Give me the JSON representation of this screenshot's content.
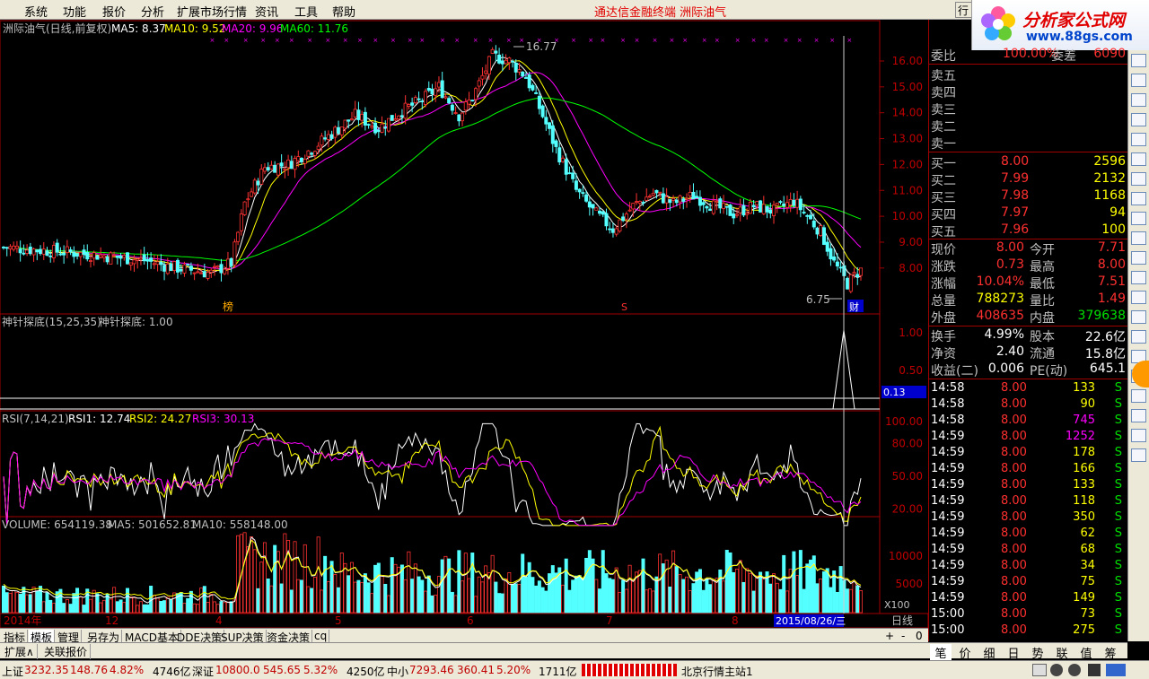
{
  "menu": {
    "items": [
      "系统",
      "功能",
      "报价",
      "分析",
      "扩展市场行情",
      "资讯",
      "工具",
      "帮助"
    ],
    "title": "通达信金融终端  洲际油气",
    "tab": "行"
  },
  "logo": {
    "line1": "分析家公式网",
    "line2": "www.88gs.com"
  },
  "chart_header": {
    "name": "洲际油气(日线,前复权)",
    "ma5": "MA5: 8.37",
    "ma10": "MA10: 9.52",
    "ma20": "MA20: 9.96",
    "ma60": "MA60: 11.76",
    "high_label": "16.77",
    "low_label": "6.75",
    "mark_bang": "榜",
    "mark_s": "S",
    "mark_cai": "财"
  },
  "chart_data": [
    {
      "type": "candlestick",
      "title": "洲际油气(日线,前复权)",
      "ylim": [
        6.6,
        16.7
      ],
      "yticks": [
        "16.00",
        "15.00",
        "14.00",
        "13.00",
        "12.00",
        "11.00",
        "10.00",
        "9.00",
        "8.00"
      ],
      "xticks": [
        "2014年",
        "12",
        "4",
        "5",
        "6",
        "7",
        "8"
      ],
      "cursor_date": "2015/08/26/三",
      "series": [
        "MA5",
        "MA10",
        "MA20",
        "MA60"
      ],
      "colors": {
        "up": "#ff3232",
        "down": "#54ffff",
        "ma5": "#ffffff",
        "ma10": "#ffff00",
        "ma20": "#ff00ff",
        "ma60": "#00ff00"
      }
    },
    {
      "type": "line",
      "title": "神针探底(15,25,35)",
      "value_label": "神针探底: 1.00",
      "yticks": [
        "1.00",
        "0.50"
      ],
      "cur": "0.13"
    },
    {
      "type": "line",
      "title": "RSI(7,14,21)",
      "rsi1": "RSI1: 12.74",
      "rsi2": "RSI2: 24.27",
      "rsi3": "RSI3: 30.13",
      "yticks": [
        "100.00",
        "80.00",
        "50.00",
        "20.00"
      ]
    },
    {
      "type": "bar",
      "title": "VOLUME: 654119.38",
      "ma5": "MA5: 501652.81",
      "ma10": "MA10: 558148.00",
      "yticks": [
        "10000",
        "5000"
      ],
      "unit": "X100"
    }
  ],
  "period": "日线",
  "zoom": {
    "plus": "+",
    "minus": "-",
    "zero": "0"
  },
  "tabs": [
    "指标",
    "模板",
    "管理",
    "另存为",
    "MACD基本",
    "DDE决策",
    "SUP决策",
    "资金决策",
    "cq"
  ],
  "tabs2": [
    "扩展∧",
    "关联报价"
  ],
  "quote": {
    "weibi": [
      "委比",
      "100.00%",
      "委差",
      "6090"
    ],
    "sell": [
      "卖五",
      "卖四",
      "卖三",
      "卖二",
      "卖一"
    ],
    "buy": [
      [
        "买一",
        "8.00",
        "2596"
      ],
      [
        "买二",
        "7.99",
        "2132"
      ],
      [
        "买三",
        "7.98",
        "1168"
      ],
      [
        "买四",
        "7.97",
        "94"
      ],
      [
        "买五",
        "7.96",
        "100"
      ]
    ],
    "stats": [
      [
        "现价",
        "8.00",
        "今开",
        "7.71"
      ],
      [
        "涨跌",
        "0.73",
        "最高",
        "8.00"
      ],
      [
        "涨幅",
        "10.04%",
        "最低",
        "7.51"
      ],
      [
        "总量",
        "788273",
        "量比",
        "1.49"
      ],
      [
        "外盘",
        "408635",
        "内盘",
        "379638"
      ]
    ],
    "fin": [
      [
        "换手",
        "4.99%",
        "股本",
        "22.6亿"
      ],
      [
        "净资",
        "2.40",
        "流通",
        "15.8亿"
      ],
      [
        "收益(二)",
        "0.006",
        "PE(动)",
        "645.1"
      ]
    ],
    "ticks": [
      [
        "14:58",
        "8.00",
        "133",
        "S"
      ],
      [
        "14:58",
        "8.00",
        "90",
        "S"
      ],
      [
        "14:58",
        "8.00",
        "745",
        "S"
      ],
      [
        "14:59",
        "8.00",
        "1252",
        "S"
      ],
      [
        "14:59",
        "8.00",
        "178",
        "S"
      ],
      [
        "14:59",
        "8.00",
        "166",
        "S"
      ],
      [
        "14:59",
        "8.00",
        "133",
        "S"
      ],
      [
        "14:59",
        "8.00",
        "118",
        "S"
      ],
      [
        "14:59",
        "8.00",
        "350",
        "S"
      ],
      [
        "14:59",
        "8.00",
        "62",
        "S"
      ],
      [
        "14:59",
        "8.00",
        "68",
        "S"
      ],
      [
        "14:59",
        "8.00",
        "34",
        "S"
      ],
      [
        "14:59",
        "8.00",
        "75",
        "S"
      ],
      [
        "14:59",
        "8.00",
        "149",
        "S"
      ],
      [
        "15:00",
        "8.00",
        "73",
        "S"
      ],
      [
        "15:00",
        "8.00",
        "275",
        "S"
      ]
    ]
  },
  "rtabs": [
    "笔",
    "价",
    "细",
    "日",
    "势",
    "联",
    "值",
    "筹"
  ],
  "status": {
    "sh_label": "上证",
    "sh": "3232.35",
    "sh_chg": "148.76",
    "sh_pct": "4.82%",
    "sh_amt": "4746亿",
    "sz_label": "深证",
    "sz": "10800.0",
    "sz_chg": "545.65",
    "sz_pct": "5.32%",
    "sz_amt": "4250亿",
    "zx_label": "中小",
    "zx": "7293.46",
    "zx_chg": "360.41",
    "zx_pct": "5.20%",
    "zx_amt": "1711亿",
    "server": "北京行情主站1"
  }
}
